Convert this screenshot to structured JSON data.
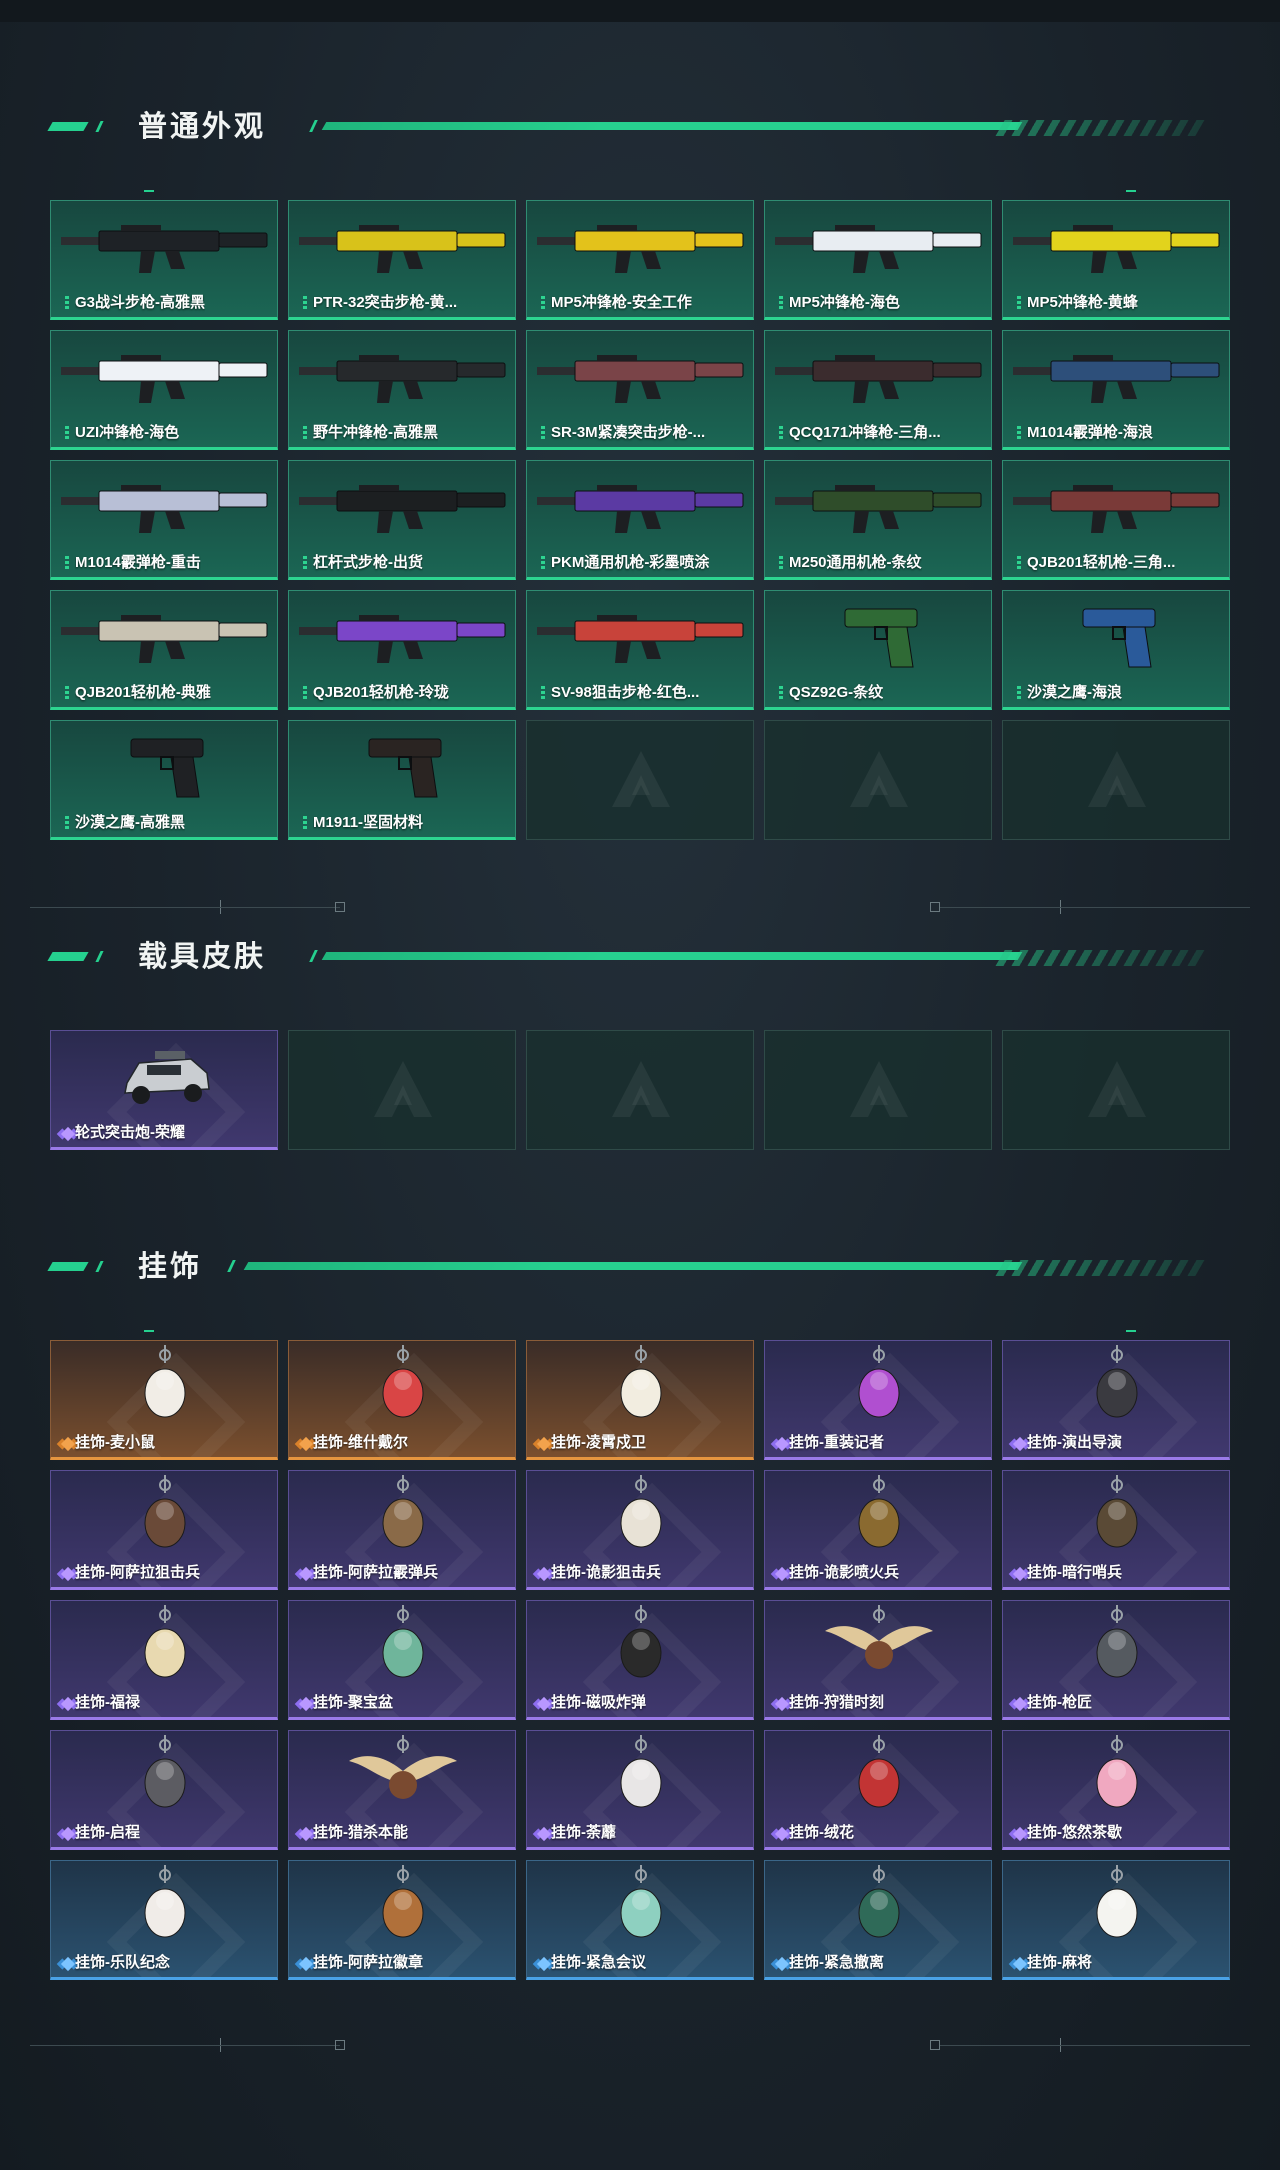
{
  "sections": {
    "weapons": {
      "title": "普通外观",
      "items": [
        {
          "label": "G3战斗步枪-高雅黑"
        },
        {
          "label": "PTR-32突击步枪-黄..."
        },
        {
          "label": "MP5冲锋枪-安全工作"
        },
        {
          "label": "MP5冲锋枪-海色"
        },
        {
          "label": "MP5冲锋枪-黄蜂"
        },
        {
          "label": "UZI冲锋枪-海色"
        },
        {
          "label": "野牛冲锋枪-高雅黑"
        },
        {
          "label": "SR-3M紧凑突击步枪-..."
        },
        {
          "label": "QCQ171冲锋枪-三角..."
        },
        {
          "label": "M1014霰弹枪-海浪"
        },
        {
          "label": "M1014霰弹枪-重击"
        },
        {
          "label": "杠杆式步枪-出货"
        },
        {
          "label": "PKM通用机枪-彩墨喷涂"
        },
        {
          "label": "M250通用机枪-条纹"
        },
        {
          "label": "QJB201轻机枪-三角..."
        },
        {
          "label": "QJB201轻机枪-典雅"
        },
        {
          "label": "QJB201轻机枪-玲珑"
        },
        {
          "label": "SV-98狙击步枪-红色..."
        },
        {
          "label": "QSZ92G-条纹"
        },
        {
          "label": "沙漠之鹰-海浪"
        },
        {
          "label": "沙漠之鹰-高雅黑"
        },
        {
          "label": "M1911-坚固材料"
        }
      ]
    },
    "vehicles": {
      "title": "载具皮肤",
      "items": [
        {
          "label": "轮式突击炮-荣耀"
        }
      ]
    },
    "charms": {
      "title": "挂饰",
      "items": [
        {
          "label": "挂饰-麦小鼠",
          "tier": "orange"
        },
        {
          "label": "挂饰-维什戴尔",
          "tier": "orange"
        },
        {
          "label": "挂饰-凌霄戍卫",
          "tier": "orange"
        },
        {
          "label": "挂饰-重装记者",
          "tier": "purple"
        },
        {
          "label": "挂饰-演出导演",
          "tier": "purple"
        },
        {
          "label": "挂饰-阿萨拉狙击兵",
          "tier": "purple"
        },
        {
          "label": "挂饰-阿萨拉霰弹兵",
          "tier": "purple"
        },
        {
          "label": "挂饰-诡影狙击兵",
          "tier": "purple"
        },
        {
          "label": "挂饰-诡影喷火兵",
          "tier": "purple"
        },
        {
          "label": "挂饰-暗行哨兵",
          "tier": "purple"
        },
        {
          "label": "挂饰-福禄",
          "tier": "purple"
        },
        {
          "label": "挂饰-聚宝盆",
          "tier": "purple"
        },
        {
          "label": "挂饰-磁吸炸弹",
          "tier": "purple"
        },
        {
          "label": "挂饰-狩猎时刻",
          "tier": "purple"
        },
        {
          "label": "挂饰-枪匠",
          "tier": "purple"
        },
        {
          "label": "挂饰-启程",
          "tier": "purple"
        },
        {
          "label": "挂饰-猎杀本能",
          "tier": "purple"
        },
        {
          "label": "挂饰-荼蘼",
          "tier": "purple"
        },
        {
          "label": "挂饰-绒花",
          "tier": "purple"
        },
        {
          "label": "挂饰-悠然茶歇",
          "tier": "purple"
        },
        {
          "label": "挂饰-乐队纪念",
          "tier": "blue"
        },
        {
          "label": "挂饰-阿萨拉徽章",
          "tier": "blue"
        },
        {
          "label": "挂饰-紧急会议",
          "tier": "blue"
        },
        {
          "label": "挂饰-紧急撤离",
          "tier": "blue"
        },
        {
          "label": "挂饰-麻将",
          "tier": "blue"
        }
      ]
    }
  },
  "colors": {
    "accent": "#27d08f",
    "tier_green": "#2dd490",
    "tier_purple": "#9a7ae8",
    "tier_orange": "#e5953f",
    "tier_blue": "#4aa2e6"
  },
  "icons": {
    "empty_slot": "triangle-logo-icon",
    "rarity": "rarity-diamond-icon"
  }
}
